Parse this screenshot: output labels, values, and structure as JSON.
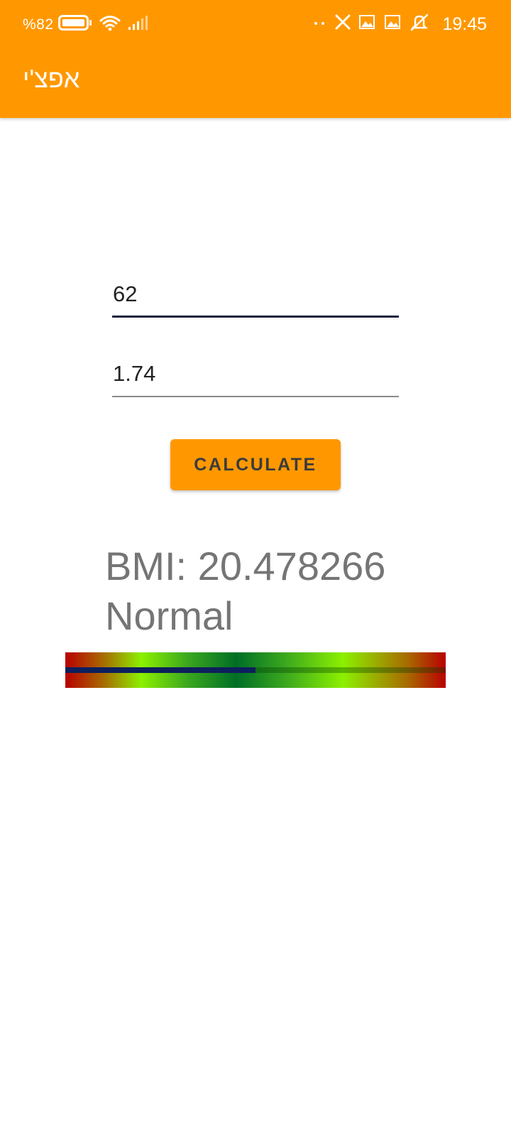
{
  "status_bar": {
    "battery_percent": "%82",
    "time": "19:45",
    "icons": [
      "battery-icon",
      "wifi-icon",
      "signal-icon",
      "dots-icon",
      "x-app-icon",
      "image-icon",
      "image-icon",
      "mute-icon"
    ]
  },
  "app_bar": {
    "title": "אפצ'י",
    "color": "#FF9800"
  },
  "form": {
    "weight_value": "62",
    "height_value": "1.74",
    "calculate_label": "CALCULATE"
  },
  "result": {
    "bmi_text": "BMI: 20.478266",
    "category": "Normal"
  },
  "bmi_bar": {
    "progress_fraction": 0.5
  }
}
